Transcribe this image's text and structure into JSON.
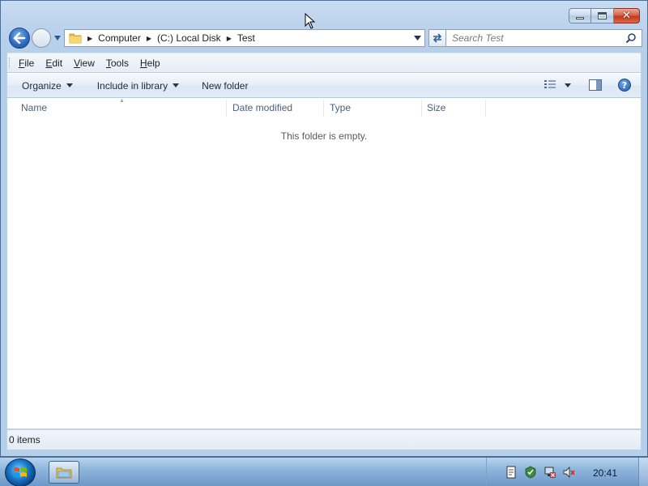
{
  "window": {
    "caption_buttons": [
      "minimize",
      "maximize",
      "close"
    ]
  },
  "nav": {
    "breadcrumbs": [
      "Computer",
      "(C:) Local Disk",
      "Test"
    ],
    "search_placeholder": "Search Test"
  },
  "menubar": {
    "items": [
      "File",
      "Edit",
      "View",
      "Tools",
      "Help"
    ]
  },
  "commandbar": {
    "organize": "Organize",
    "include_in_library": "Include in library",
    "new_folder": "New folder"
  },
  "columns": [
    "Name",
    "Date modified",
    "Type",
    "Size"
  ],
  "content": {
    "empty_message": "This folder is empty."
  },
  "status": {
    "items_count": "0 items"
  },
  "taskbar": {
    "clock": "20:41"
  },
  "colors": {
    "accent": "#2f6dc4",
    "window_frame": "#b6cfea",
    "taskbar": "#6d98c8"
  }
}
